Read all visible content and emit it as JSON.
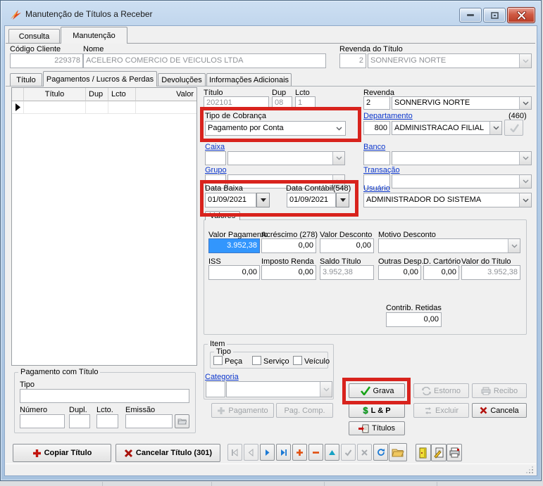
{
  "window": {
    "title": "Manutenção de Títulos a Receber"
  },
  "main_tabs": {
    "consulta": "Consulta",
    "manutencao": "Manutenção"
  },
  "header": {
    "codigo_cliente_label": "Código Cliente",
    "codigo_cliente_value": "229378",
    "nome_label": "Nome",
    "nome_value": "ACELERO COMERCIO DE VEICULOS LTDA",
    "revenda_titulo_label": "Revenda do Título",
    "revenda_titulo_code": "2",
    "revenda_titulo_name": "SONNERVIG NORTE"
  },
  "inner_tabs": {
    "titulo": "Título",
    "pagamentos": "Pagamentos / Lucros & Perdas",
    "devolucoes": "Devoluções",
    "info": "Informações Adicionais"
  },
  "grid": {
    "columns": [
      "Título",
      "Dup",
      "Lcto",
      "Valor"
    ]
  },
  "detail": {
    "titulo_label": "Título",
    "titulo_value": "202101",
    "dup_label": "Dup",
    "dup_value": "08",
    "lcto_label": "Lcto",
    "lcto_value": "1",
    "revenda_label": "Revenda",
    "revenda_code": "2",
    "revenda_name": "SONNERVIG NORTE",
    "tipo_cobranca_label": "Tipo de Cobrança",
    "tipo_cobranca_value": "Pagamento por Conta",
    "departamento_label": "Departamento",
    "departamento_badge": "(460)",
    "departamento_code": "800",
    "departamento_name": "ADMINISTRACAO FILIAL",
    "caixa_label": "Caixa",
    "banco_label": "Banco",
    "grupo_label": "Grupo",
    "transacao_label": "Transação",
    "data_baixa_label": "Data Baixa",
    "data_baixa_value": "01/09/2021",
    "data_contabil_label": "Data Contábil(548)",
    "data_contabil_value": "01/09/2021",
    "usuario_label": "Usuário",
    "usuario_value": "ADMINISTRADOR DO SISTEMA"
  },
  "valores": {
    "tab_label": "Valores",
    "valor_pagamento_label": "Valor Pagamento",
    "valor_pagamento_value": "3.952,38",
    "acrescimo_label": "Acréscimo (278)",
    "acrescimo_value": "0,00",
    "valor_desconto_label": "Valor Desconto",
    "valor_desconto_value": "0,00",
    "motivo_desconto_label": "Motivo Desconto",
    "iss_label": "ISS",
    "iss_value": "0,00",
    "imposto_renda_label": "Imposto Renda",
    "imposto_renda_value": "0,00",
    "saldo_titulo_label": "Saldo Título",
    "saldo_titulo_value": "3.952,38",
    "outras_desp_label": "Outras Desp.",
    "outras_desp_value": "0,00",
    "d_cartorio_label": "D. Cartório",
    "d_cartorio_value": "0,00",
    "valor_do_titulo_label": "Valor do Título",
    "valor_do_titulo_value": "3.952,38",
    "contrib_retidas_label": "Contrib. Retidas",
    "contrib_retidas_value": "0,00"
  },
  "item": {
    "caption": "Item",
    "tipo_caption": "Tipo",
    "peca": "Peça",
    "servico": "Serviço",
    "veiculo": "Veículo",
    "categoria_label": "Categoria"
  },
  "pagamento_com_titulo": {
    "caption": "Pagamento com Título",
    "tipo_label": "Tipo",
    "numero_label": "Número",
    "dupl_label": "Dupl.",
    "lcto_label": "Lcto.",
    "emissao_label": "Emissão"
  },
  "buttons": {
    "pagamento": "Pagamento",
    "pag_comp": "Pag. Comp.",
    "grava": "Grava",
    "estorno": "Estorno",
    "recibo": "Recibo",
    "lp": "L & P",
    "excluir": "Excluir",
    "cancela": "Cancela",
    "titulos": "Títulos",
    "copiar_titulo": "Copiar Título",
    "cancelar_titulo": "Cancelar Título (301)"
  },
  "colors": {
    "highlight_red": "#d8231d",
    "link_blue": "#0a35cc",
    "selection_blue": "#3296fd",
    "close_button_red": "#b83b24"
  }
}
